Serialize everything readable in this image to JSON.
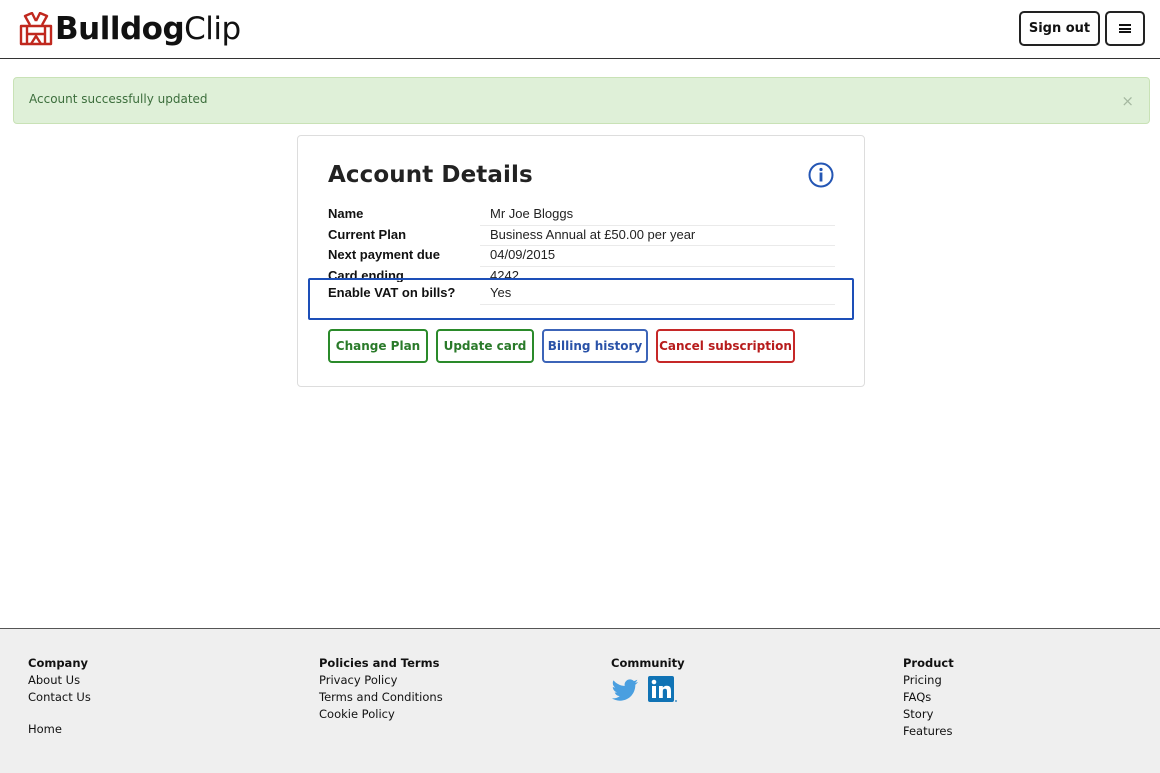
{
  "header": {
    "logo_bold": "Bulldog",
    "logo_light": "Clip",
    "signout_label": "Sign out"
  },
  "alert": {
    "message": "Account successfully updated",
    "close_symbol": "×"
  },
  "account": {
    "title": "Account Details",
    "rows": [
      {
        "label": "Name",
        "value": "Mr Joe Bloggs"
      },
      {
        "label": "Current Plan",
        "value": "Business Annual at £50.00 per year"
      },
      {
        "label": "Next payment due",
        "value": "04/09/2015"
      },
      {
        "label": "Card ending",
        "value": "4242"
      },
      {
        "label": "Enable VAT on bills?",
        "value": "Yes"
      }
    ],
    "buttons": {
      "change_plan": "Change Plan",
      "update_card": "Update card",
      "billing_history": "Billing history",
      "cancel_subscription": "Cancel subscription"
    }
  },
  "footer": {
    "company": {
      "heading": "Company",
      "links": [
        "About Us",
        "Contact Us"
      ],
      "home": "Home"
    },
    "policies": {
      "heading": "Policies and Terms",
      "links": [
        "Privacy Policy",
        "Terms and Conditions",
        "Cookie Policy"
      ]
    },
    "community": {
      "heading": "Community",
      "icons": [
        "twitter-icon",
        "linkedin-icon"
      ]
    },
    "product": {
      "heading": "Product",
      "links": [
        "Pricing",
        "FAQs",
        "Story",
        "Features"
      ]
    }
  },
  "colors": {
    "alert_bg": "#dff0d8",
    "green": "#2a8a2a",
    "blue": "#3c64b8",
    "red": "#c62828",
    "highlight": "#1d4fb8"
  }
}
